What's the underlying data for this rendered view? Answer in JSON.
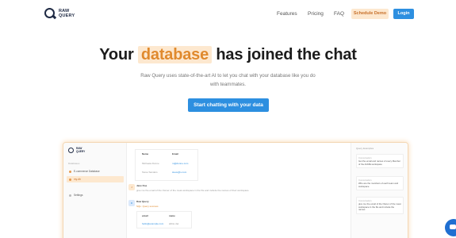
{
  "brand": {
    "line1": "RAW",
    "line2": "QUERY"
  },
  "nav": {
    "links": [
      "Features",
      "Pricing",
      "FAQ"
    ],
    "schedule_demo": "Schedule Demo",
    "login": "Login"
  },
  "hero": {
    "title_before": "Your",
    "title_highlight": "database",
    "title_after": "has joined the chat",
    "subtitle": "Raw Query uses state-of-the-art AI to let you chat with your database like you do with teammates.",
    "cta": "Start chatting with your data"
  },
  "preview": {
    "sidebar": {
      "section": "Databases",
      "items": [
        "E-commerce Database",
        "my-db",
        "Settings"
      ]
    },
    "table": {
      "headers": [
        "Name",
        "Email"
      ],
      "rows": [
        [
          "Michaela Dunne",
          "m@dunne.com"
        ],
        [
          "Steve Sanders",
          "steve@s.com"
        ]
      ]
    },
    "messages": [
      {
        "author": "Jane Doe",
        "text": "give me the email of the Owner of the meat workspace in the file and include the names of their workspace"
      },
      {
        "author": "Raw Query",
        "text": "SQL: Query success"
      }
    ],
    "table2": {
      "headers": [
        "email",
        "name"
      ],
      "rows": [
        [
          "hello@example.com",
          "abbie dar"
        ]
      ]
    },
    "right_panel": {
      "title": "Query Examples",
      "cards": [
        {
          "h": "Conversation",
          "b": "Get the email and names of every Member of the ACME workspace"
        },
        {
          "h": "Conversation",
          "b": "Who are the members of each team and workspace"
        },
        {
          "h": "Conversation",
          "b": "give me the email of the Owner of the meat workspace in the file and include the names"
        }
      ]
    }
  }
}
